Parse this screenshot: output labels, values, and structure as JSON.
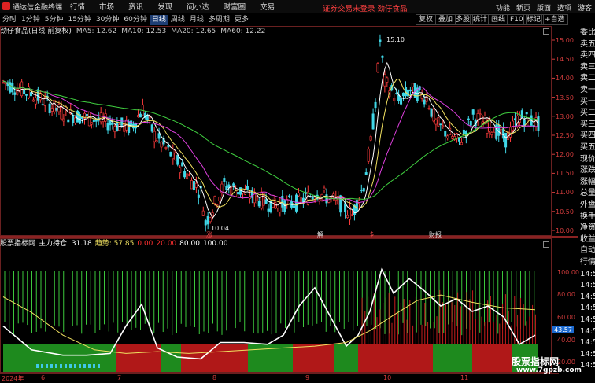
{
  "app": {
    "title": "通达信金融终端"
  },
  "menu": [
    "行情",
    "市场",
    "资讯",
    "发现",
    "问小达",
    "财富圈",
    "交易"
  ],
  "promo": "证券交易未登录  劲仔食品",
  "top_right": [
    "功能",
    "新页",
    "版面",
    "选项",
    "游客"
  ],
  "periods": [
    "分时",
    "1分钟",
    "5分钟",
    "15分钟",
    "30分钟",
    "60分钟",
    "日线",
    "周线",
    "月线",
    "多周期",
    "更多"
  ],
  "active_period": "日线",
  "tools": [
    "复权",
    "叠加",
    "多股",
    "统计",
    "画线",
    "F10",
    "标记",
    "+自选"
  ],
  "stock": {
    "title": "劲仔食品(日线 前复权)",
    "ma": [
      {
        "label": "MA5: 12.62",
        "color": "#ffffff"
      },
      {
        "label": "MA10: 12.53",
        "color": "#f0e060"
      },
      {
        "label": "MA20: 12.65",
        "color": "#e040e0"
      },
      {
        "label": "MA60: 12.22",
        "color": "#40d040"
      }
    ],
    "high_label": "15.10",
    "low_label": "10.04",
    "event_tags": [
      "涨",
      "解",
      "$",
      "财报"
    ]
  },
  "price_axis": [
    "15.00",
    "14.50",
    "14.00",
    "13.50",
    "13.00",
    "12.50",
    "12.00",
    "11.50",
    "11.00",
    "10.50",
    "10.00"
  ],
  "indicator": {
    "name": "股票指标网",
    "items": [
      {
        "label": "主力持仓: 31.18",
        "color": "#ffffff"
      },
      {
        "label": "趋势: 57.85",
        "color": "#f0e060"
      },
      {
        "label": "0.00",
        "color": "#ff3030"
      },
      {
        "label": "20.00",
        "color": "#ff3030"
      },
      {
        "label": "80.00",
        "color": "#ffffff"
      },
      {
        "label": "100.00",
        "color": "#ffffff"
      }
    ],
    "axis": [
      "100.00",
      "80.00",
      "60.00",
      "40.00",
      "20.00"
    ],
    "current_value": "43.57"
  },
  "right_panel": [
    "委比",
    "卖五",
    "卖四",
    "卖三",
    "卖二",
    "卖一",
    "买一",
    "买二",
    "买三",
    "买四",
    "买五",
    "现价",
    "涨跌",
    "涨幅",
    "总量",
    "外盘",
    "换手",
    "净资",
    "收益",
    "自动",
    "行情",
    "14:5",
    "14:5",
    "14:5",
    "14:5",
    "14:5",
    "14:5",
    "14:5",
    "14:5",
    "14:5"
  ],
  "time_axis": [
    "2024年",
    "6",
    "7",
    "8",
    "9",
    "10",
    "11"
  ],
  "watermark": {
    "line1": "股票指标网",
    "line2": "www.7gpzb.com"
  }
}
